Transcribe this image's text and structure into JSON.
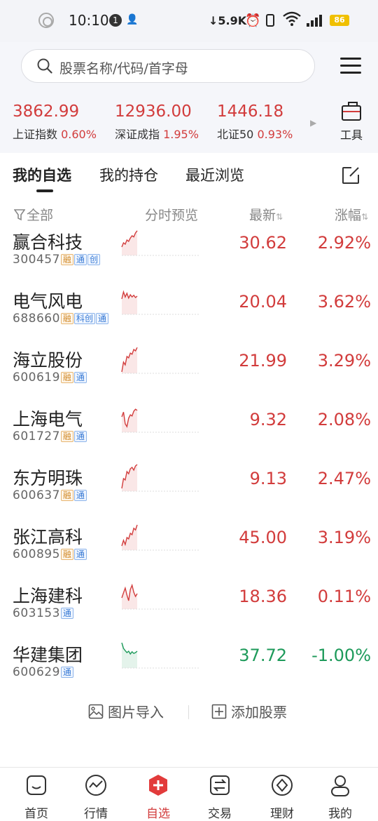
{
  "status_bar": {
    "time": "10:10",
    "notification_count": "1",
    "net_speed": "5.9K",
    "battery": "86"
  },
  "search": {
    "placeholder": "股票名称/代码/首字母"
  },
  "indices": [
    {
      "value": "3862.99",
      "name": "上证指数",
      "change": "0.60%"
    },
    {
      "value": "12936.00",
      "name": "深证成指",
      "change": "1.95%"
    },
    {
      "value": "1446.18",
      "name": "北证50",
      "change": "0.93%"
    }
  ],
  "tools_label": "工具",
  "tabs": [
    {
      "label": "我的自选",
      "active": true
    },
    {
      "label": "我的持仓",
      "active": false
    },
    {
      "label": "最近浏览",
      "active": false
    }
  ],
  "list_header": {
    "filter": "全部",
    "preview": "分时预览",
    "latest": "最新",
    "change": "涨幅"
  },
  "stocks": [
    {
      "name": "赢合科技",
      "code": "300457",
      "tags": [
        "融",
        "通",
        "创"
      ],
      "price": "30.62",
      "change": "2.92%",
      "direction": "up",
      "trend": [
        0.3,
        0.45,
        0.4,
        0.55,
        0.5,
        0.62,
        0.7,
        0.66,
        0.8,
        0.88
      ]
    },
    {
      "name": "电气风电",
      "code": "688660",
      "tags": [
        "融",
        "科创",
        "通"
      ],
      "price": "20.04",
      "change": "3.62%",
      "direction": "up",
      "trend": [
        0.55,
        0.8,
        0.62,
        0.75,
        0.58,
        0.7,
        0.62,
        0.68,
        0.6,
        0.65
      ]
    },
    {
      "name": "海立股份",
      "code": "600619",
      "tags": [
        "融",
        "通"
      ],
      "price": "21.99",
      "change": "3.29%",
      "direction": "up",
      "trend": [
        0.05,
        0.4,
        0.3,
        0.6,
        0.55,
        0.72,
        0.68,
        0.85,
        0.8,
        0.92
      ]
    },
    {
      "name": "上海电气",
      "code": "601727",
      "tags": [
        "融",
        "通"
      ],
      "price": "9.32",
      "change": "2.08%",
      "direction": "up",
      "trend": [
        0.55,
        0.72,
        0.3,
        0.2,
        0.5,
        0.62,
        0.58,
        0.75,
        0.82,
        0.78
      ]
    },
    {
      "name": "东方明珠",
      "code": "600637",
      "tags": [
        "融",
        "通"
      ],
      "price": "9.13",
      "change": "2.47%",
      "direction": "up",
      "trend": [
        0.1,
        0.45,
        0.4,
        0.7,
        0.62,
        0.8,
        0.85,
        0.75,
        0.9,
        0.95
      ]
    },
    {
      "name": "张江高科",
      "code": "600895",
      "tags": [
        "融",
        "通"
      ],
      "price": "45.00",
      "change": "3.19%",
      "direction": "up",
      "trend": [
        0.15,
        0.35,
        0.2,
        0.45,
        0.4,
        0.6,
        0.55,
        0.78,
        0.72,
        0.9
      ]
    },
    {
      "name": "上海建科",
      "code": "603153",
      "tags": [
        "通"
      ],
      "price": "18.36",
      "change": "0.11%",
      "direction": "up",
      "trend": [
        0.4,
        0.58,
        0.75,
        0.5,
        0.3,
        0.7,
        0.85,
        0.6,
        0.45,
        0.55
      ]
    },
    {
      "name": "华建集团",
      "code": "600629",
      "tags": [
        "通"
      ],
      "price": "37.72",
      "change": "-1.00%",
      "direction": "down",
      "trend": [
        0.9,
        0.7,
        0.62,
        0.55,
        0.6,
        0.5,
        0.58,
        0.52,
        0.55,
        0.6
      ]
    }
  ],
  "actions": {
    "import": "图片导入",
    "add": "添加股票"
  },
  "bottom_nav": [
    {
      "label": "首页",
      "icon": "home-icon"
    },
    {
      "label": "行情",
      "icon": "market-icon"
    },
    {
      "label": "自选",
      "icon": "watchlist-icon",
      "active": true
    },
    {
      "label": "交易",
      "icon": "trade-icon"
    },
    {
      "label": "理财",
      "icon": "finance-icon"
    },
    {
      "label": "我的",
      "icon": "profile-icon"
    }
  ],
  "colors": {
    "up": "#d23c3c",
    "down": "#1d9a5a",
    "accent": "#e23b3b"
  }
}
